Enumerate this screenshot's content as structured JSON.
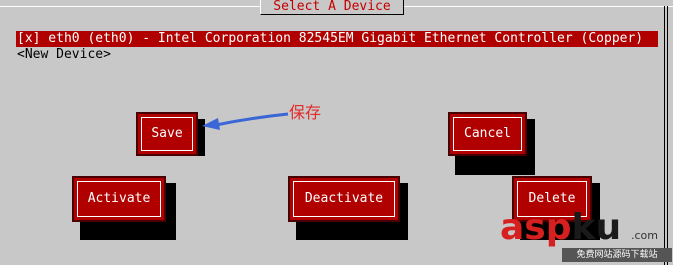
{
  "dialog": {
    "title": "Select A Device"
  },
  "devices": [
    {
      "label": "[x] eth0 (eth0) - Intel Corporation 82545EM Gigabit Ethernet Controller (Copper)",
      "selected": true
    },
    {
      "label": "<New Device>",
      "selected": false
    }
  ],
  "buttons": {
    "save": "Save",
    "cancel": "Cancel",
    "activate": "Activate",
    "deactivate": "Deactivate",
    "delete": "Delete"
  },
  "annotation": {
    "text": "保存",
    "color": "#e52a2a",
    "arrow_color": "#3a66d6"
  },
  "watermark": {
    "brand_red": "asp",
    "brand_dark": "ku",
    "suffix": ".com",
    "subtitle": "免费网站源码下载站"
  },
  "colors": {
    "background": "#c8c8c8",
    "accent": "#b00000",
    "title_text": "#c40000"
  }
}
